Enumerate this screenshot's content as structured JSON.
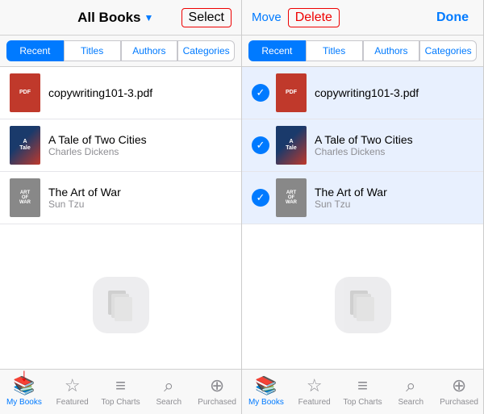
{
  "left_panel": {
    "header": {
      "title": "All Books",
      "chevron": "▼",
      "select_label": "Select"
    },
    "tabs": [
      {
        "label": "Recent",
        "active": true
      },
      {
        "label": "Titles",
        "active": false
      },
      {
        "label": "Authors",
        "active": false
      },
      {
        "label": "Categories",
        "active": false
      }
    ],
    "books": [
      {
        "id": "pdf",
        "title": "copywriting101-3.pdf",
        "author": "",
        "type": "pdf"
      },
      {
        "id": "atoc",
        "title": "A Tale of Two Cities",
        "author": "Charles Dickens",
        "type": "atoc"
      },
      {
        "id": "aow",
        "title": "The Art of War",
        "author": "Sun Tzu",
        "type": "aow"
      }
    ],
    "bottom": [
      {
        "label": "My Books",
        "active": true,
        "icon": "📚"
      },
      {
        "label": "Featured",
        "active": false,
        "icon": "☆"
      },
      {
        "label": "Top Charts",
        "active": false,
        "icon": "≡"
      },
      {
        "label": "Search",
        "active": false,
        "icon": "⌕"
      },
      {
        "label": "Purchased",
        "active": false,
        "icon": "⊕"
      }
    ]
  },
  "right_panel": {
    "header": {
      "move_label": "Move",
      "delete_label": "Delete",
      "done_label": "Done"
    },
    "tabs": [
      {
        "label": "Recent",
        "active": true
      },
      {
        "label": "Titles",
        "active": false
      },
      {
        "label": "Authors",
        "active": false
      },
      {
        "label": "Categories",
        "active": false
      }
    ],
    "books": [
      {
        "id": "pdf",
        "title": "copywriting101-3.pdf",
        "author": "",
        "type": "pdf",
        "selected": true
      },
      {
        "id": "atoc",
        "title": "A Tale of Two Cities",
        "author": "Charles Dickens",
        "type": "atoc",
        "selected": true
      },
      {
        "id": "aow",
        "title": "The Art of War",
        "author": "Sun Tzu",
        "type": "aow",
        "selected": true
      }
    ],
    "bottom": [
      {
        "label": "My Books",
        "active": true,
        "icon": "📚"
      },
      {
        "label": "Featured",
        "active": false,
        "icon": "☆"
      },
      {
        "label": "Top Charts",
        "active": false,
        "icon": "≡"
      },
      {
        "label": "Search",
        "active": false,
        "icon": "⌕"
      },
      {
        "label": "Purchased",
        "active": false,
        "icon": "⊕"
      }
    ]
  }
}
